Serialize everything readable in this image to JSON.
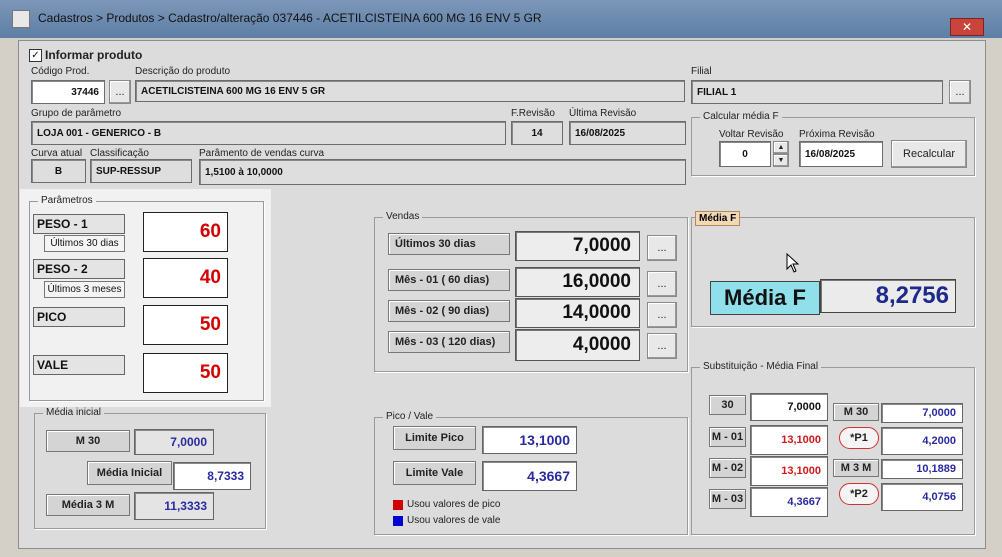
{
  "window": {
    "title": "Cadastros > Produtos > Cadastro/alteração  037446 - ACETILCISTEINA 600 MG 16 ENV 5 GR",
    "close_glyph": "✕"
  },
  "informar": {
    "label": "Informar produto",
    "checked": true,
    "check_glyph": "✓"
  },
  "produto": {
    "codigo_label": "Código Prod.",
    "codigo": "37446",
    "descricao_label": "Descrição do  produto",
    "descricao": "ACETILCISTEINA 600 MG 16 ENV 5 GR",
    "filial_label": "Filial",
    "filial": "FILIAL 1",
    "grupo_label": "Grupo de parâmetro",
    "grupo": "LOJA 001 - GENERICO - B",
    "frevisao_label": "F.Revisão",
    "frevisao": "14",
    "ultima_label": "Última Revisão",
    "ultima": "16/08/2025",
    "curva_label": "Curva atual",
    "curva": "B",
    "classif_label": "Classificação",
    "classif": "SUP-RESSUP",
    "param_curva_label": "Parâmento de vendas curva",
    "param_curva": "1,5100   à   10,0000",
    "ellipsis": "..."
  },
  "calcular": {
    "title": "Calcular média F",
    "voltar_label": "Voltar Revisão",
    "voltar": "0",
    "proxima_label": "Próxima Revisão",
    "proxima": "16/08/2025",
    "recalcular": "Recalcular",
    "up": "▲",
    "down": "▼"
  },
  "parametros": {
    "title": "Parâmetros",
    "peso1": "PESO - 1",
    "peso1_sub": "Últimos 30 dias",
    "peso1_val": "60",
    "peso2": "PESO - 2",
    "peso2_sub": "Últimos 3 meses",
    "peso2_val": "40",
    "pico": "PICO",
    "pico_val": "50",
    "vale": "VALE",
    "vale_val": "50"
  },
  "vendas": {
    "title": "Vendas",
    "rows": [
      {
        "label": "Últimos 30 dias",
        "value": "7,0000"
      },
      {
        "label": "Mês - 01 ( 60 dias)",
        "value": "16,0000"
      },
      {
        "label": "Mês - 02 ( 90 dias)",
        "value": "14,0000"
      },
      {
        "label": "Mês - 03 ( 120 dias)",
        "value": "4,0000"
      }
    ]
  },
  "media_f": {
    "title": "Média F",
    "label": "Média F",
    "value": "8,2756"
  },
  "media_inicial": {
    "title": "Média inicial",
    "m30_label": "M 30",
    "m30": "7,0000",
    "mi_label": "Média Inicial",
    "mi": "8,7333",
    "m3m_label": "Média 3 M",
    "m3m": "11,3333"
  },
  "pico_vale": {
    "title": "Pico / Vale",
    "pico_label": "Limite Pico",
    "pico": "13,1000",
    "vale_label": "Limite Vale",
    "vale": "4,3667",
    "legend_pico": "Usou valores de pico",
    "legend_vale": "Usou valores de vale",
    "color_pico": "#d00000",
    "color_vale": "#0000d0"
  },
  "substituicao": {
    "title": "Substituição - Média Final",
    "left": [
      {
        "label": "30",
        "value": "7,0000"
      },
      {
        "label": "M - 01",
        "value": "13,1000"
      },
      {
        "label": "M - 02",
        "value": "13,1000"
      },
      {
        "label": "M - 03",
        "value": "4,3667"
      }
    ],
    "right": [
      {
        "label": "M 30",
        "value": "7,0000"
      },
      {
        "label": "*P1",
        "value": "4,2000"
      },
      {
        "label": "M 3 M",
        "value": "10,1889"
      },
      {
        "label": "*P2",
        "value": "4,0756"
      }
    ]
  }
}
